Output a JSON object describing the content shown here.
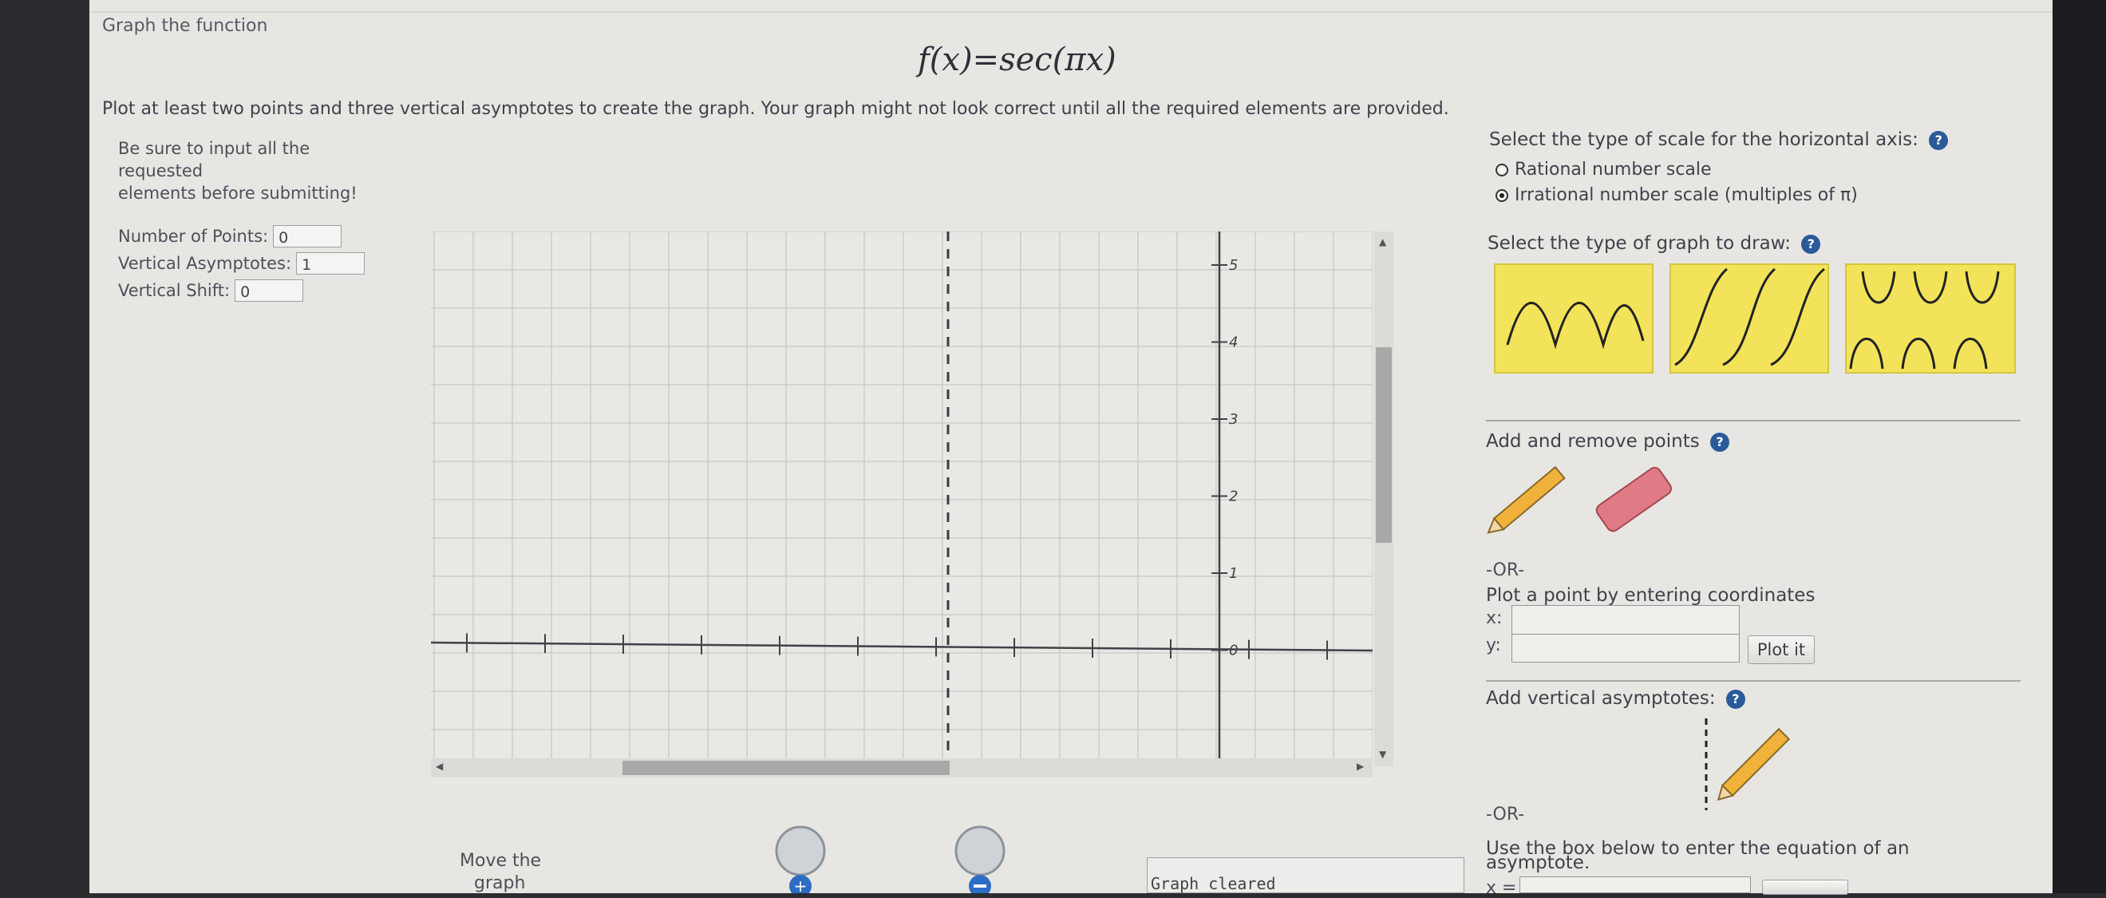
{
  "header": {
    "title": "Graph the function"
  },
  "problem": {
    "formula": "f(x)=sec(πx)",
    "instructions": "Plot at least two points and three vertical asymptotes to create the graph. Your graph might not look correct until all the required elements are provided."
  },
  "note": {
    "line1": "Be sure to input all the",
    "line2": "requested",
    "line3": "elements before submitting!"
  },
  "counters": {
    "points_label": "Number of Points:",
    "points_value": "0",
    "asymptotes_label": "Vertical Asymptotes:",
    "asymptotes_value": "1",
    "shift_label": "Vertical Shift:",
    "shift_value": "0"
  },
  "graph": {
    "y_ticks": [
      "5",
      "4",
      "3",
      "2",
      "1",
      "0"
    ]
  },
  "scale": {
    "title": "Select the type of scale for the horizontal axis:",
    "option_rational": "Rational number scale",
    "option_irrational": "Irrational number scale (multiples of π)",
    "selected": "irrational"
  },
  "graph_type": {
    "title": "Select the type of graph to draw:"
  },
  "points_tool": {
    "title": "Add and remove points",
    "or": "-OR-",
    "enter_label": "Plot a point by entering coordinates",
    "x_label": "x:",
    "y_label": "y:",
    "plot_button": "Plot it"
  },
  "asymptote_tool": {
    "title": "Add vertical asymptotes:",
    "or": "-OR-",
    "enter_label_1": "Use the box below to enter the equation of an",
    "enter_label_2": "asymptote.",
    "x_label": "x ="
  },
  "bottom": {
    "move_label_1": "Move the",
    "move_label_2": "graph",
    "status": "Graph cleared"
  },
  "colors": {
    "thumb_yellow": "#f2e35a",
    "help_blue": "#2a5a9a",
    "pencil": "#f0b23a",
    "eraser": "#e07a84"
  }
}
